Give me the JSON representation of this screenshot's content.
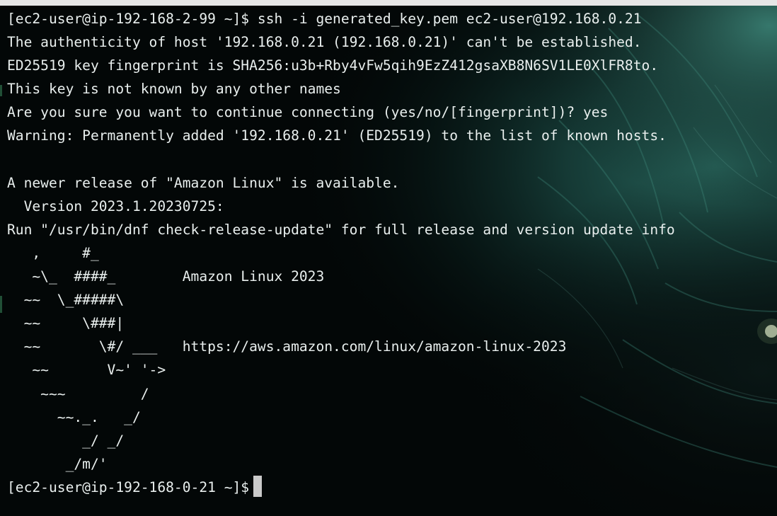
{
  "terminal": {
    "lines": [
      "[ec2-user@ip-192-168-2-99 ~]$ ssh -i generated_key.pem ec2-user@192.168.0.21",
      "The authenticity of host '192.168.0.21 (192.168.0.21)' can't be established.",
      "ED25519 key fingerprint is SHA256:u3b+Rby4vFw5qih9EzZ412gsaXB8N6SV1LE0XlFR8to.",
      "This key is not known by any other names",
      "Are you sure you want to continue connecting (yes/no/[fingerprint])? yes",
      "Warning: Permanently added '192.168.0.21' (ED25519) to the list of known hosts.",
      "",
      "A newer release of \"Amazon Linux\" is available.",
      "  Version 2023.1.20230725:",
      "Run \"/usr/bin/dnf check-release-update\" for full release and version update info",
      "   ,     #_",
      "   ~\\_  ####_        Amazon Linux 2023",
      "  ~~  \\_#####\\",
      "  ~~     \\###|",
      "  ~~       \\#/ ___   https://aws.amazon.com/linux/amazon-linux-2023",
      "   ~~       V~' '->",
      "    ~~~         /",
      "      ~~._.   _/",
      "         _/ _/",
      "       _/m/'"
    ],
    "prompt": "[ec2-user@ip-192-168-0-21 ~]$",
    "colors": {
      "background": "#030707",
      "text": "#e9efee",
      "cursor": "#c9c9c9",
      "accent": "#2f6e64"
    }
  }
}
